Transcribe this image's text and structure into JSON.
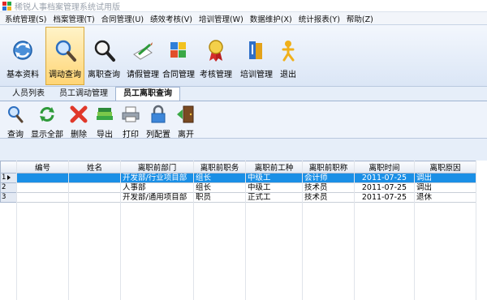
{
  "window": {
    "title": "稀锐人事档案管理系统试用版"
  },
  "menu": [
    "系统管理(S)",
    "档案管理(T)",
    "合同管理(U)",
    "绩效考核(V)",
    "培训管理(W)",
    "数据维护(X)",
    "统计报表(Y)",
    "帮助(Z)"
  ],
  "main_toolbar": [
    {
      "label": "基本资料",
      "icon": "refresh-globe-icon"
    },
    {
      "label": "调动查询",
      "icon": "magnifier-icon",
      "active": true
    },
    {
      "label": "离职查询",
      "icon": "magnifier-icon"
    },
    {
      "label": "请假管理",
      "icon": "pen-paper-icon"
    },
    {
      "label": "合同管理",
      "icon": "puzzle-icon"
    },
    {
      "label": "考核管理",
      "icon": "award-icon"
    },
    {
      "label": "培训管理",
      "icon": "books-icon"
    },
    {
      "label": "退出",
      "icon": "exit-person-icon"
    }
  ],
  "tabs": [
    "人员列表",
    "员工调动管理",
    "员工离职查询"
  ],
  "sub_toolbar": [
    {
      "label": "查询",
      "icon": "magnifier-icon"
    },
    {
      "label": "显示全部",
      "icon": "refresh-icon"
    },
    {
      "label": "删除",
      "icon": "delete-x-icon"
    },
    {
      "label": "导出",
      "icon": "export-books-icon"
    },
    {
      "label": "打印",
      "icon": "printer-icon"
    },
    {
      "label": "列配置",
      "icon": "lock-icon"
    },
    {
      "label": "离开",
      "icon": "door-exit-icon"
    }
  ],
  "grid": {
    "columns": [
      "编号",
      "姓名",
      "离职前部门",
      "离职前职务",
      "离职前工种",
      "离职前职称",
      "离职时间",
      "离职原因"
    ],
    "rows": [
      {
        "n": "1",
        "cells": [
          "",
          "",
          "开发部/行业项目部",
          "组长",
          "中级工",
          "会计师",
          "2011-07-25",
          "调出"
        ],
        "selected": true
      },
      {
        "n": "2",
        "cells": [
          "",
          "",
          "人事部",
          "组长",
          "中级工",
          "技术员",
          "2011-07-25",
          "调出"
        ]
      },
      {
        "n": "3",
        "cells": [
          "",
          "",
          "开发部/通用项目部",
          "职员",
          "正式工",
          "技术员",
          "2011-07-25",
          "退休"
        ]
      }
    ]
  },
  "colors": {
    "selection": "#1a8fe6",
    "active_button": "#ffd575"
  }
}
